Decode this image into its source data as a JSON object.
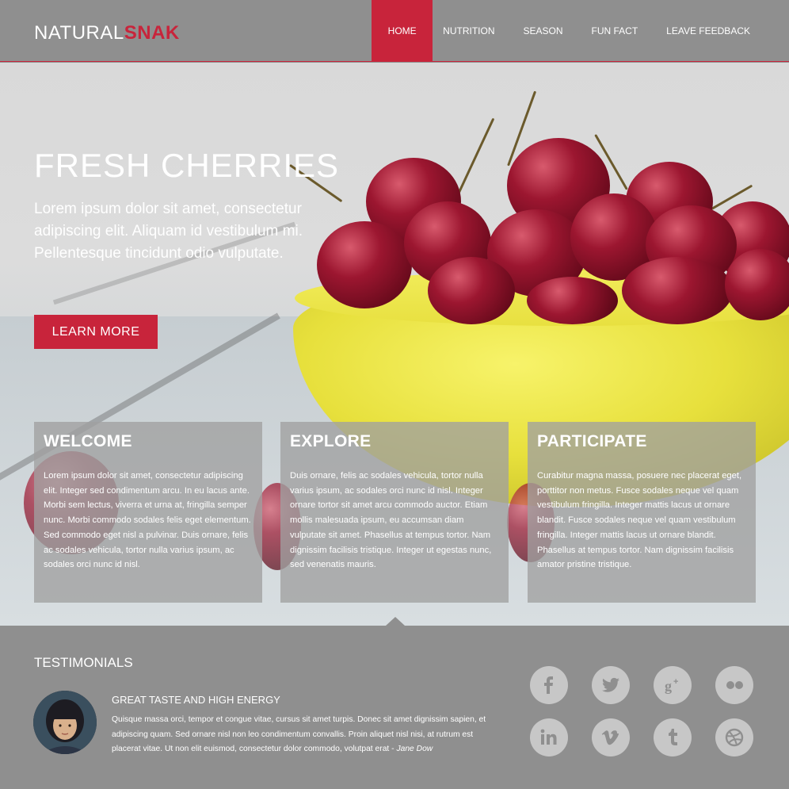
{
  "logo": {
    "part1": "NATURAL",
    "part2": "SNAK"
  },
  "nav": {
    "items": [
      {
        "label": "HOME"
      },
      {
        "label": "NUTRITION"
      },
      {
        "label": "SEASON"
      },
      {
        "label": "FUN FACT"
      },
      {
        "label": "LEAVE FEEDBACK"
      }
    ]
  },
  "hero": {
    "title": "FRESH CHERRIES",
    "text": "Lorem ipsum dolor sit amet, consectetur adipiscing elit. Aliquam id vestibulum mi. Pellentesque tincidunt odio vulputate.",
    "button": "LEARN MORE"
  },
  "cards": [
    {
      "title": "WELCOME",
      "text": "Lorem ipsum dolor sit amet, consectetur adipiscing elit. Integer sed condimentum arcu. In eu lacus ante. Morbi sem lectus, viverra et urna at, fringilla semper nunc. Morbi commodo sodales felis eget elementum. Sed commodo eget nisl a pulvinar. Duis ornare, felis ac sodales vehicula, tortor nulla varius ipsum, ac sodales orci nunc id nisl."
    },
    {
      "title": "EXPLORE",
      "text": "Duis ornare, felis ac sodales vehicula, tortor nulla varius ipsum, ac sodales orci nunc id nisl. Integer ornare tortor sit amet arcu commodo auctor. Etiam mollis malesuada ipsum, eu accumsan diam vulputate sit amet. Phasellus at tempus tortor. Nam dignissim facilisis tristique. Integer ut egestas nunc, sed venenatis mauris."
    },
    {
      "title": "PARTICIPATE",
      "text": "Curabitur magna massa, posuere nec placerat eget, porttitor non metus. Fusce sodales neque vel quam vestibulum fringilla. Integer mattis lacus ut ornare blandit. Fusce sodales neque vel quam vestibulum fringilla. Integer mattis lacus ut ornare blandit. Phasellus at tempus tortor. Nam dignissim facilisis amator pristine tristique."
    }
  ],
  "testimonials": {
    "heading": "TESTIMONIALS",
    "title": "GREAT TASTE AND HIGH ENERGY",
    "body": "Quisque massa orci, tempor et congue vitae, cursus sit amet turpis. Donec sit amet dignissim sapien, et adipiscing quam. Sed ornare nisl non leo condimentum convallis. Proin aliquet nisl nisi, at rutrum est placerat vitae. Ut non elit euismod, consectetur dolor commodo, volutpat erat - ",
    "author": "Jane Dow"
  },
  "social": [
    {
      "icon": "facebook-icon",
      "glyph": "f"
    },
    {
      "icon": "twitter-icon",
      "glyph": "t"
    },
    {
      "icon": "google-plus-icon",
      "glyph": "g+"
    },
    {
      "icon": "flickr-icon",
      "glyph": "••"
    },
    {
      "icon": "linkedin-icon",
      "glyph": "in"
    },
    {
      "icon": "vimeo-icon",
      "glyph": "v"
    },
    {
      "icon": "tumblr-icon",
      "glyph": "t"
    },
    {
      "icon": "dribbble-icon",
      "glyph": "◎"
    }
  ],
  "colors": {
    "accent": "#c8243b",
    "panel": "#8f8f8f",
    "icon": "#c7c7c7"
  }
}
